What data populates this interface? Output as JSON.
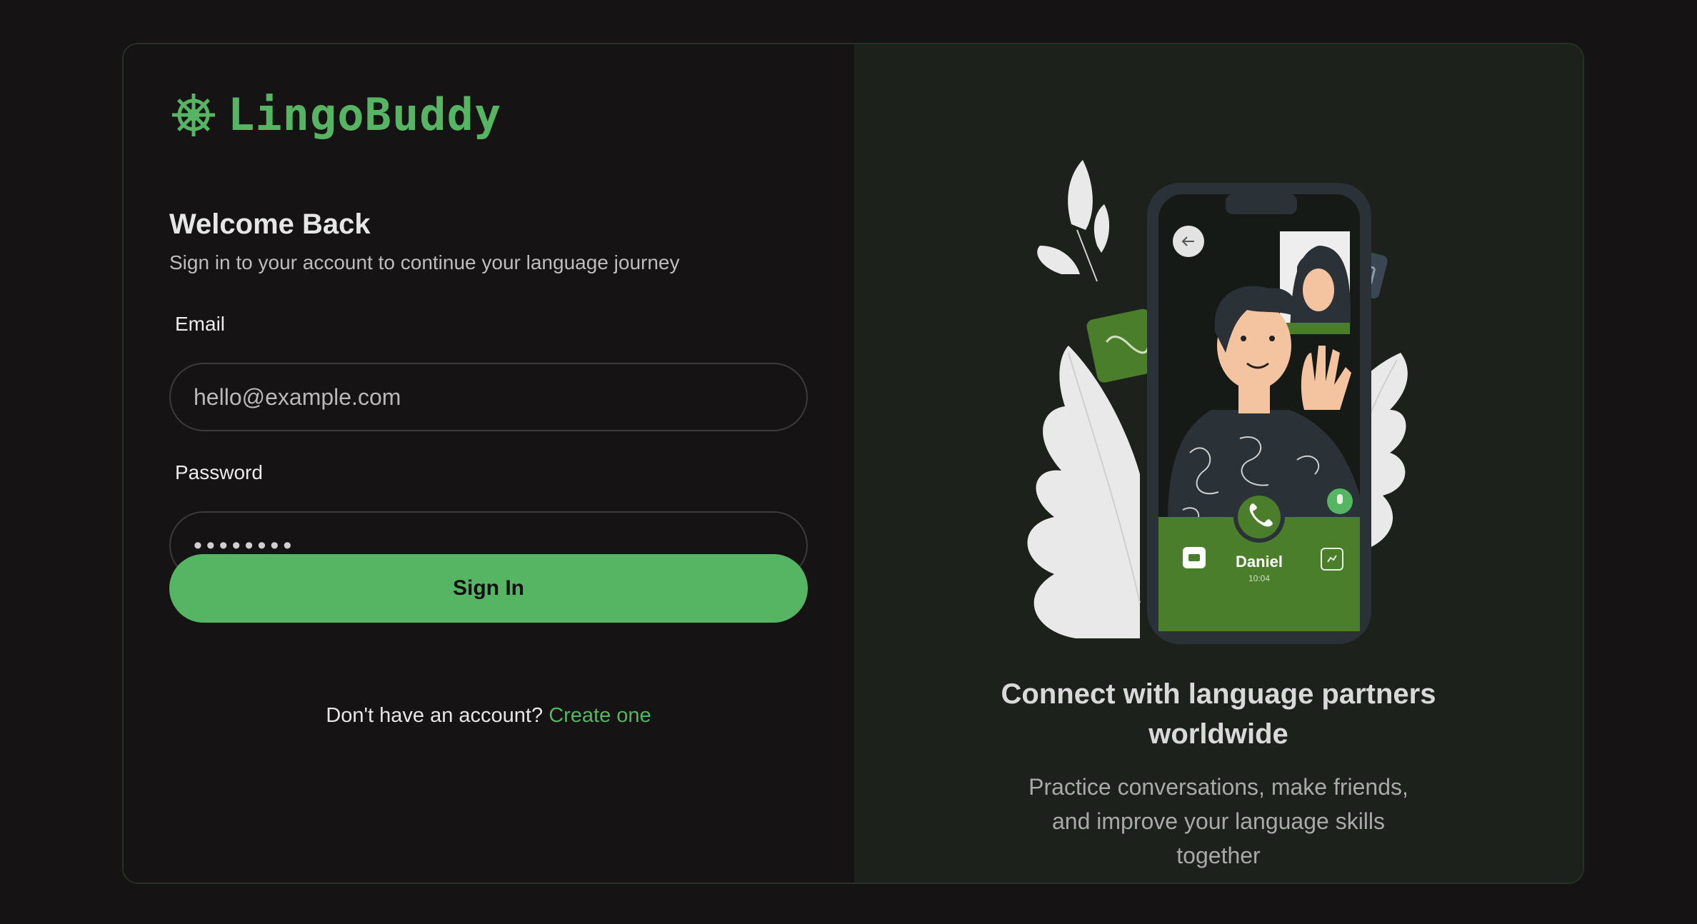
{
  "brand": {
    "name": "LingoBuddy",
    "icon": "ship-wheel-icon"
  },
  "login": {
    "title": "Welcome Back",
    "subtitle": "Sign in to your account to continue your language journey",
    "email_label": "Email",
    "email_placeholder": "hello@example.com",
    "password_label": "Password",
    "password_value": "••••••••",
    "submit_label": "Sign In",
    "signup_prompt": "Don't have an account?",
    "signup_link": "Create one"
  },
  "promo": {
    "caller_name": "Daniel",
    "call_time": "10:04",
    "headline": "Connect with language partners worldwide",
    "description": "Practice conversations, make friends, and improve your language skills together"
  },
  "colors": {
    "accent": "#56b562",
    "background": "#151313",
    "panel": "#1c211c"
  }
}
